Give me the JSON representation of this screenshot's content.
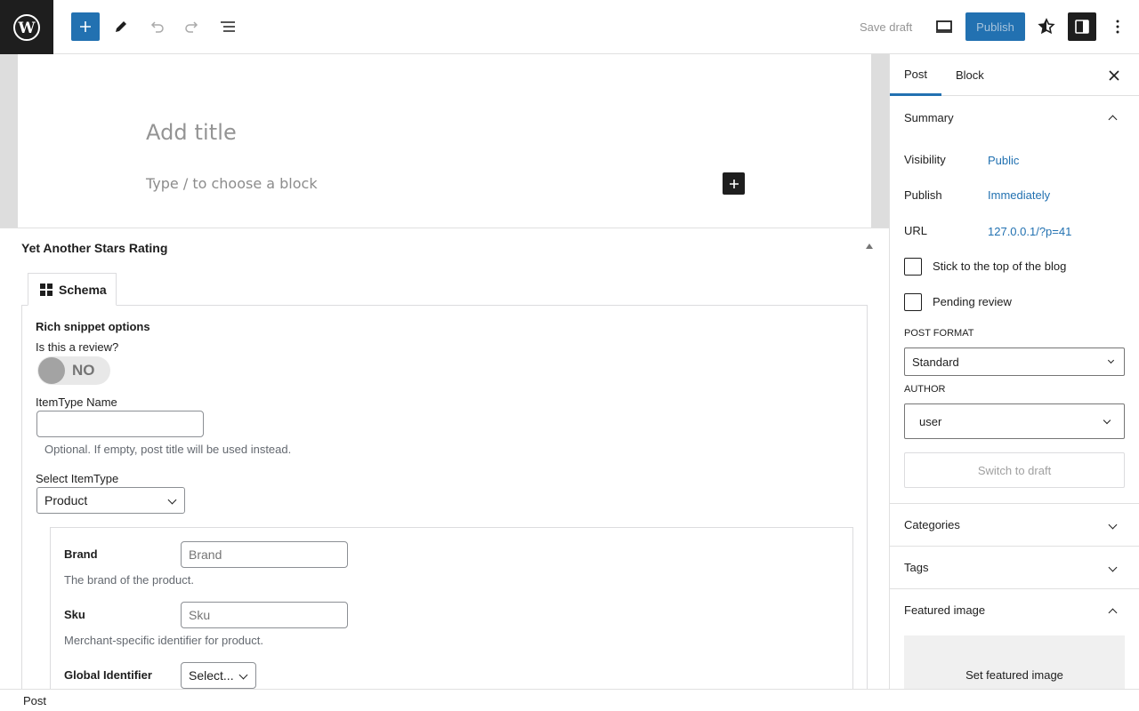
{
  "topbar": {
    "logo": "wordpress-logo",
    "tools": [
      "add-block",
      "edit-tools",
      "undo",
      "redo",
      "document-overview"
    ],
    "save_draft": "Save draft",
    "publish": "Publish",
    "right_icons": [
      "preview",
      "star-plugin",
      "settings",
      "options"
    ]
  },
  "editor": {
    "title_placeholder": "Add title",
    "block_placeholder": "Type / to choose a block"
  },
  "metabox": {
    "title": "Yet Another Stars Rating",
    "tab": "Schema",
    "heading": "Rich snippet options",
    "review_question": "Is this a review?",
    "review_toggle": "NO",
    "itemtype_name_label": "ItemType Name",
    "itemtype_name_value": "",
    "itemtype_help": "Optional. If empty, post title will be used instead.",
    "select_itemtype_label": "Select ItemType",
    "select_itemtype_value": "Product",
    "fields": {
      "brand_label": "Brand",
      "brand_placeholder": "Brand",
      "brand_help": "The brand of the product.",
      "sku_label": "Sku",
      "sku_placeholder": "Sku",
      "sku_help": "Merchant-specific identifier for product.",
      "global_id_label": "Global Identifier",
      "global_id_value": "Select..."
    }
  },
  "sidebar": {
    "tabs": [
      "Post",
      "Block"
    ],
    "summary": {
      "title": "Summary",
      "visibility_label": "Visibility",
      "visibility_value": "Public",
      "publish_label": "Publish",
      "publish_value": "Immediately",
      "url_label": "URL",
      "url_value": "127.0.0.1/?p=41",
      "sticky_label": "Stick to the top of the blog",
      "pending_label": "Pending review",
      "post_format_label": "POST FORMAT",
      "post_format_value": "Standard",
      "author_label": "AUTHOR",
      "author_value": "user",
      "switch_draft": "Switch to draft"
    },
    "categories": "Categories",
    "tags": "Tags",
    "featured_image": "Featured image",
    "set_featured_image": "Set featured image"
  },
  "footer": {
    "breadcrumb": "Post"
  },
  "colors": {
    "accent": "#2271b1",
    "dark": "#1e1e1e"
  }
}
